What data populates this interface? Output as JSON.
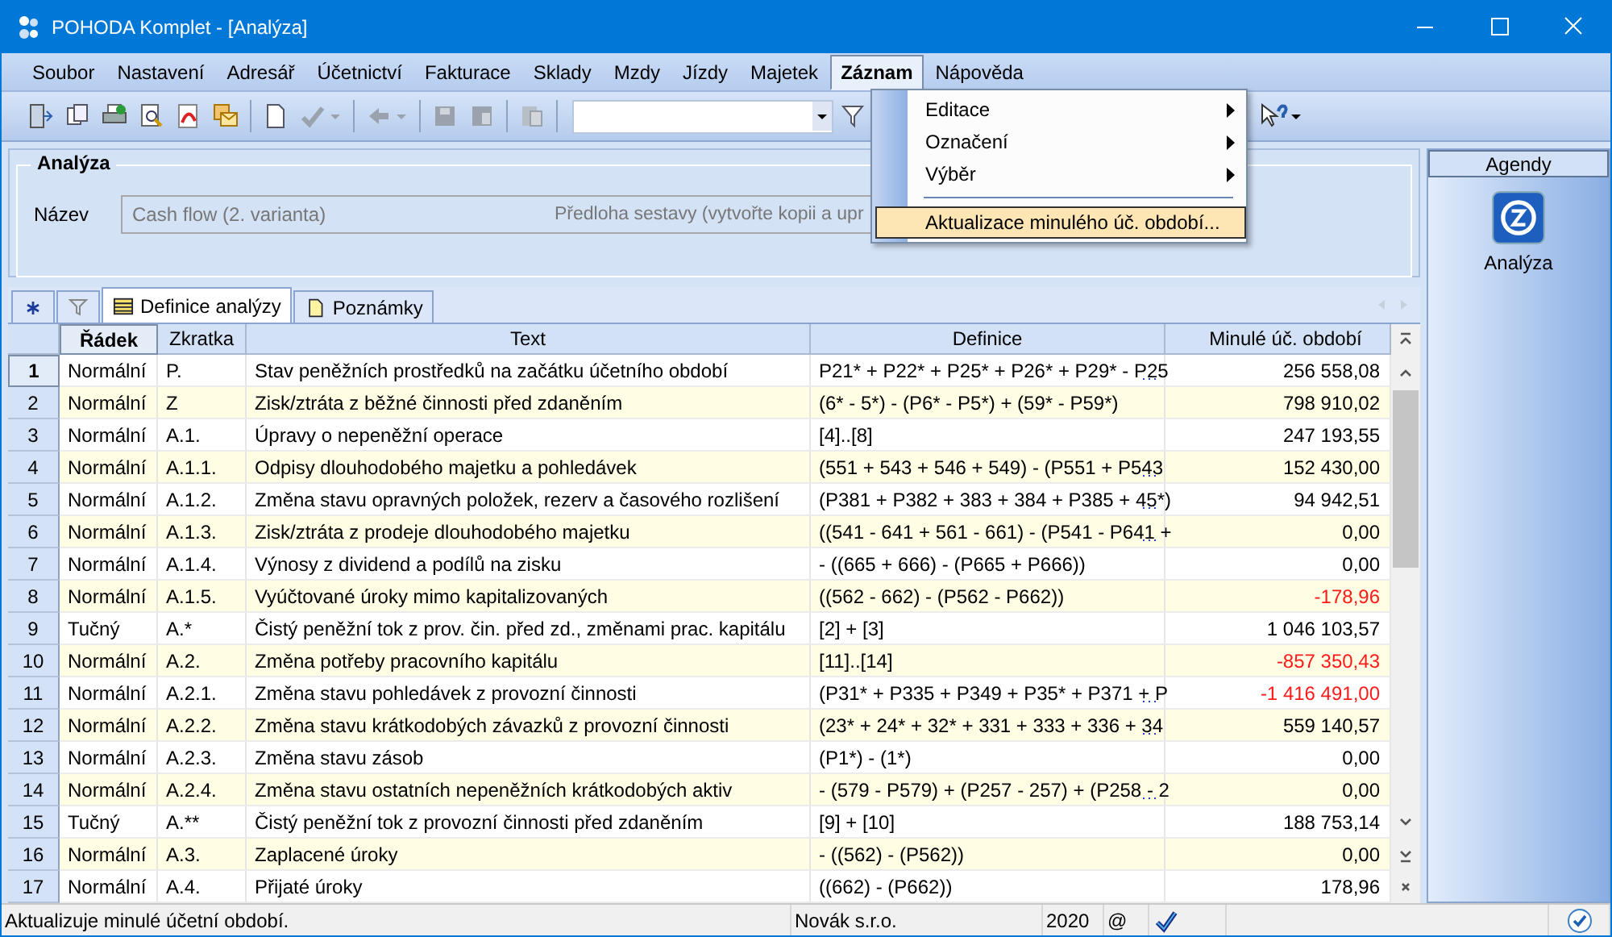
{
  "window": {
    "title": "POHODA Komplet - [Analýza]"
  },
  "menu": [
    {
      "label": "Soubor",
      "selected": false
    },
    {
      "label": "Nastavení",
      "selected": false
    },
    {
      "label": "Adresář",
      "selected": false
    },
    {
      "label": "Účetnictví",
      "selected": false
    },
    {
      "label": "Fakturace",
      "selected": false
    },
    {
      "label": "Sklady",
      "selected": false
    },
    {
      "label": "Mzdy",
      "selected": false
    },
    {
      "label": "Jízdy",
      "selected": false
    },
    {
      "label": "Majetek",
      "selected": false
    },
    {
      "label": "Záznam",
      "selected": true
    },
    {
      "label": "Nápověda",
      "selected": false
    }
  ],
  "dropdown": [
    {
      "kind": "submenu",
      "label": "Editace",
      "selected": false
    },
    {
      "kind": "submenu",
      "label": "Označení",
      "selected": false
    },
    {
      "kind": "submenu",
      "label": "Výběr",
      "selected": false
    },
    {
      "kind": "separator"
    },
    {
      "kind": "item",
      "label": "Aktualizace minulého úč. období...",
      "selected": true
    }
  ],
  "group": {
    "title": "Analýza",
    "field_label": "Název",
    "value": "Cash flow (2. varianta)",
    "note": "Předloha sestavy (vytvořte kopii a upr"
  },
  "tabs": [
    {
      "kind": "star",
      "selected": false
    },
    {
      "kind": "filter",
      "selected": false
    },
    {
      "kind": "list",
      "label": "Definice analýzy",
      "selected": true
    },
    {
      "kind": "note",
      "label": "Poznámky",
      "selected": false
    }
  ],
  "table": {
    "columns": [
      "Řádek",
      "Zkratka",
      "Text",
      "Definice",
      "Minulé úč. období"
    ],
    "rows": [
      {
        "num": "1",
        "selected": true,
        "style": "Normální",
        "abbr": "P.",
        "text": "Stav peněžních prostředků na začátku účetního období",
        "definition": "P21* + P22* + P25* + P26* + P29* - P25",
        "more": true,
        "value": "256 558,08",
        "negative": false
      },
      {
        "num": "2",
        "selected": false,
        "style": "Normální",
        "abbr": "Z",
        "text": "Zisk/ztráta z běžné činnosti před zdaněním",
        "definition": "(6* - 5*) - (P6* - P5*) + (59* - P59*)",
        "more": false,
        "value": "798 910,02",
        "negative": false
      },
      {
        "num": "3",
        "selected": false,
        "style": "Normální",
        "abbr": "A.1.",
        "text": "Úpravy o nepeněžní operace",
        "definition": "[4]..[8]",
        "more": false,
        "value": "247 193,55",
        "negative": false
      },
      {
        "num": "4",
        "selected": false,
        "style": "Normální",
        "abbr": "A.1.1.",
        "text": "Odpisy dlouhodobého majetku a pohledávek",
        "definition": "(551 + 543 + 546 + 549) - (P551 + P543",
        "more": true,
        "value": "152 430,00",
        "negative": false
      },
      {
        "num": "5",
        "selected": false,
        "style": "Normální",
        "abbr": "A.1.2.",
        "text": "Změna stavu opravných položek, rezerv a časového rozlišení",
        "definition": "(P381 + P382 + 383 + 384 + P385 + 45*)",
        "more": true,
        "value": "94 942,51",
        "negative": false
      },
      {
        "num": "6",
        "selected": false,
        "style": "Normální",
        "abbr": "A.1.3.",
        "text": "Zisk/ztráta z prodeje dlouhodobého majetku",
        "definition": "((541 - 641 + 561 - 661) - (P541 - P641 +",
        "more": true,
        "value": "0,00",
        "negative": false
      },
      {
        "num": "7",
        "selected": false,
        "style": "Normální",
        "abbr": "A.1.4.",
        "text": "Výnosy z dividend a podílů na zisku",
        "definition": " - ((665 + 666) - (P665 + P666))",
        "more": false,
        "value": "0,00",
        "negative": false
      },
      {
        "num": "8",
        "selected": false,
        "style": "Normální",
        "abbr": "A.1.5.",
        "text": "Vyúčtované úroky mimo kapitalizovaných",
        "definition": "((562 - 662) - (P562 - P662))",
        "more": false,
        "value": "-178,96",
        "negative": true
      },
      {
        "num": "9",
        "selected": false,
        "style": "Tučný",
        "abbr": "A.*",
        "text": "Čistý peněžní tok z prov. čin. před zd., změnami prac. kapitálu",
        "definition": "[2] + [3]",
        "more": false,
        "value": "1 046 103,57",
        "negative": false
      },
      {
        "num": "10",
        "selected": false,
        "style": "Normální",
        "abbr": "A.2.",
        "text": "Změna potřeby pracovního kapitálu",
        "definition": "[11]..[14]",
        "more": false,
        "value": "-857 350,43",
        "negative": true
      },
      {
        "num": "11",
        "selected": false,
        "style": "Normální",
        "abbr": "A.2.1.",
        "text": "Změna stavu pohledávek z provozní činnosti",
        "definition": "(P31* + P335 + P349 + P35* + P371 + P",
        "more": true,
        "value": "-1 416 491,00",
        "negative": true
      },
      {
        "num": "12",
        "selected": false,
        "style": "Normální",
        "abbr": "A.2.2.",
        "text": "Změna stavu krátkodobých závazků z provozní činnosti",
        "definition": "(23* + 24* + 32* + 331 + 333 + 336 + 34",
        "more": true,
        "value": "559 140,57",
        "negative": false
      },
      {
        "num": "13",
        "selected": false,
        "style": "Normální",
        "abbr": "A.2.3.",
        "text": "Změna stavu zásob",
        "definition": "(P1*) - (1*)",
        "more": false,
        "value": "0,00",
        "negative": false
      },
      {
        "num": "14",
        "selected": false,
        "style": "Normální",
        "abbr": "A.2.4.",
        "text": "Změna stavu ostatních nepeněžních krátkodobých aktiv",
        "definition": "- (579 - P579) + (P257 - 257) + (P258 - 2",
        "more": true,
        "value": "0,00",
        "negative": false
      },
      {
        "num": "15",
        "selected": false,
        "style": "Tučný",
        "abbr": "A.**",
        "text": "Čistý peněžní tok z provozní činnosti před zdaněním",
        "definition": "[9] + [10]",
        "more": false,
        "value": "188 753,14",
        "negative": false
      },
      {
        "num": "16",
        "selected": false,
        "style": "Normální",
        "abbr": "A.3.",
        "text": "Zaplacené úroky",
        "definition": " - ((562) - (P562))",
        "more": false,
        "value": "0,00",
        "negative": false
      },
      {
        "num": "17",
        "selected": false,
        "style": "Normální",
        "abbr": "A.4.",
        "text": "Přijaté úroky",
        "definition": "((662) - (P662))",
        "more": false,
        "value": "178,96",
        "negative": false
      }
    ]
  },
  "agendy": {
    "title": "Agendy",
    "items": [
      {
        "label": "Analýza",
        "selected": false
      }
    ]
  },
  "status_bar": {
    "message": "Aktualizuje minulé účetní období.",
    "company": "Novák s.r.o.",
    "year": "2020",
    "at": "@"
  }
}
